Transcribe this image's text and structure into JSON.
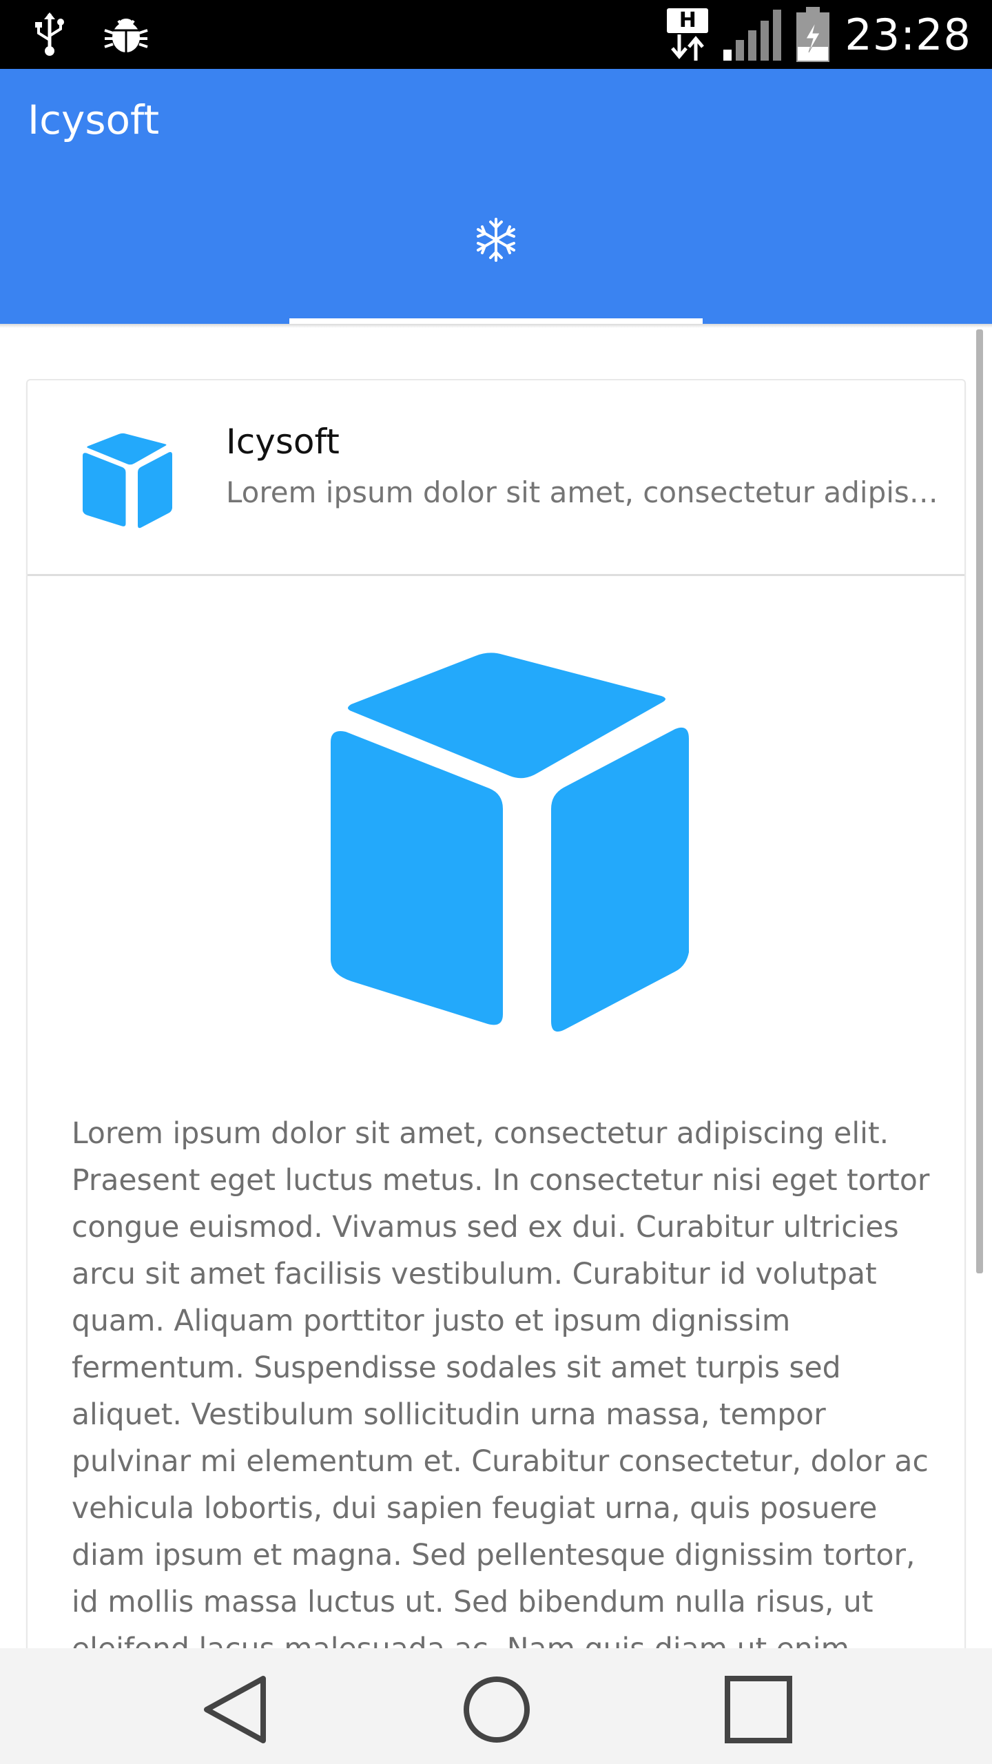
{
  "status_bar": {
    "time": "23:28",
    "network_type": "H",
    "icons": [
      "usb-icon",
      "debug-bug-icon",
      "network-h-icon",
      "signal-icon",
      "battery-charging-icon"
    ]
  },
  "app_bar": {
    "title": "Icysoft",
    "tab_icon": "snowflake-icon",
    "color": "#3a83f1"
  },
  "card": {
    "avatar_icon": "cube-icon",
    "title": "Icysoft",
    "subtitle": "Lorem ipsum dolor sit amet, consectetur adipiscing elit.",
    "image_icon": "cube-icon",
    "cube_color": "#23a9fb",
    "body": "Lorem ipsum dolor sit amet, consectetur adipiscing elit. Praesent eget luctus metus. In consectetur nisi eget tortor congue euismod. Vivamus sed ex dui. Curabitur ultricies arcu sit amet facilisis vestibulum. Curabitur id volutpat quam. Aliquam porttitor justo et ipsum dignissim fermentum. Suspendisse sodales sit amet turpis sed aliquet. Vestibulum sollicitudin urna massa, tempor pulvinar mi elementum et. Curabitur consectetur, dolor ac vehicula lobortis, dui sapien feugiat urna, quis posuere diam ipsum et magna. Sed pellentesque dignissim tortor, id mollis massa luctus ut. Sed bibendum nulla risus, ut eleifend lacus malesuada ac. Nam quis diam ut enim"
  },
  "nav_bar": {
    "buttons": [
      "back-icon",
      "home-icon",
      "recents-icon"
    ]
  }
}
